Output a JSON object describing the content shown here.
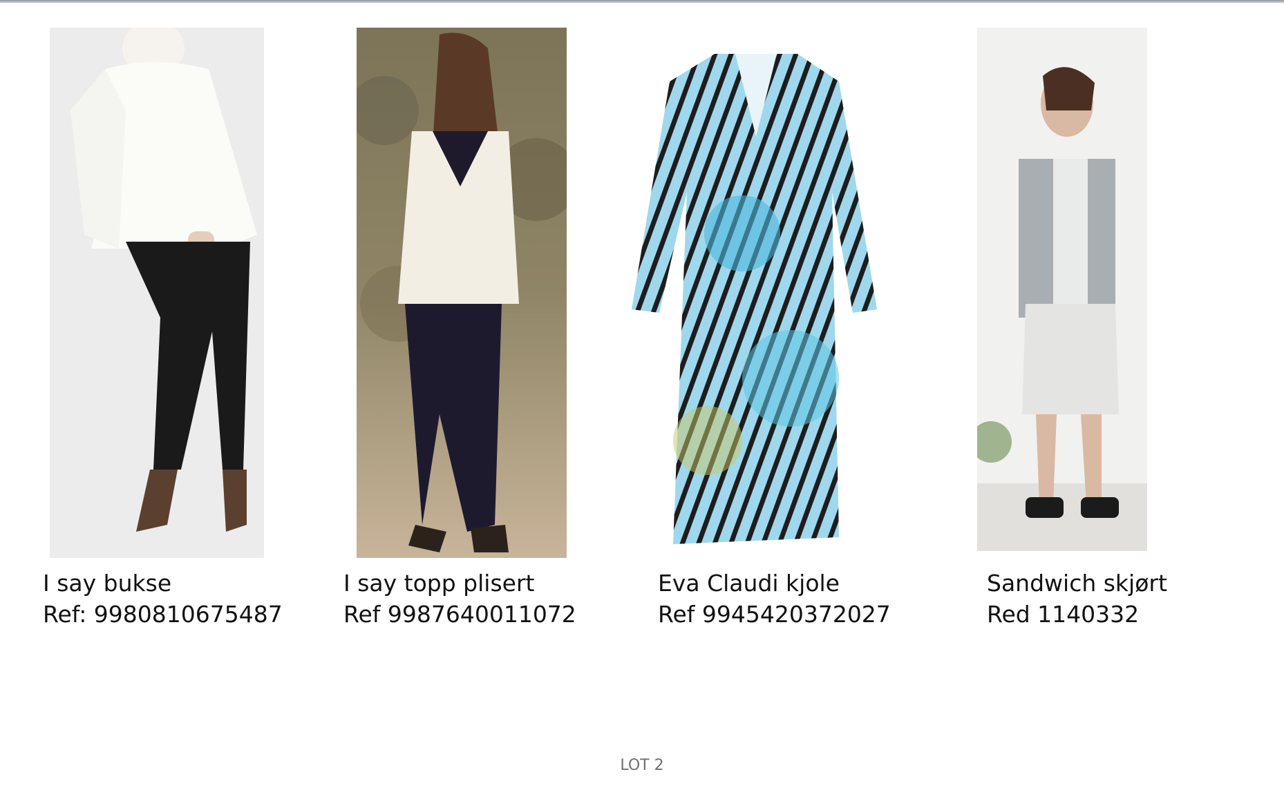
{
  "products": [
    {
      "name": "I say bukse",
      "ref": "Ref: 9980810675487",
      "image": "white-blouse-black-trousers"
    },
    {
      "name": "I say topp plisert",
      "ref": "Ref 9987640011072",
      "image": "white-top-outdoor-back-view"
    },
    {
      "name": "Eva Claudi kjole",
      "ref": "Ref 9945420372027",
      "image": "printed-wrap-dress"
    },
    {
      "name": "Sandwich skjørt",
      "ref": "Red 1140332",
      "image": "grey-jacket-printed-skirt"
    }
  ],
  "footer": {
    "label": "LOT 2"
  }
}
